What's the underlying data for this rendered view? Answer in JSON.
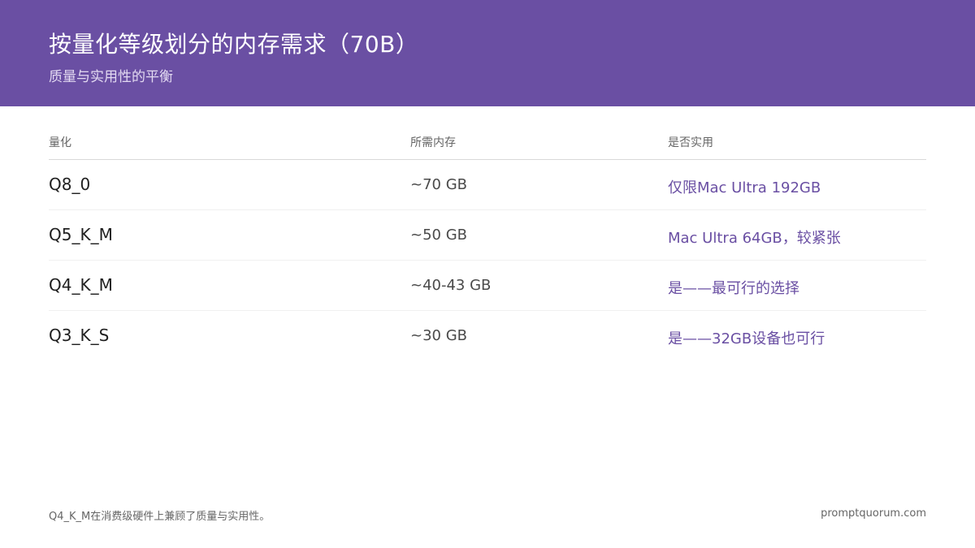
{
  "header": {
    "title": "按量化等级划分的内存需求（70B）",
    "subtitle": "质量与实用性的平衡"
  },
  "table": {
    "columns": [
      "量化",
      "所需内存",
      "是否实用"
    ],
    "rows": [
      {
        "quant": "Q8_0",
        "memory": "~70 GB",
        "practical": "仅限Mac Ultra 192GB"
      },
      {
        "quant": "Q5_K_M",
        "memory": "~50 GB",
        "practical": "Mac Ultra 64GB，较紧张"
      },
      {
        "quant": "Q4_K_M",
        "memory": "~40-43 GB",
        "practical": "是——最可行的选择"
      },
      {
        "quant": "Q3_K_S",
        "memory": "~30 GB",
        "practical": "是——32GB设备也可行"
      }
    ]
  },
  "footer": {
    "note": "Q4_K_M在消费级硬件上兼顾了质量与实用性。",
    "site": "promptquorum.com"
  },
  "colors": {
    "header_bg": "#6a4fa3",
    "accent": "#6a4fa3"
  }
}
